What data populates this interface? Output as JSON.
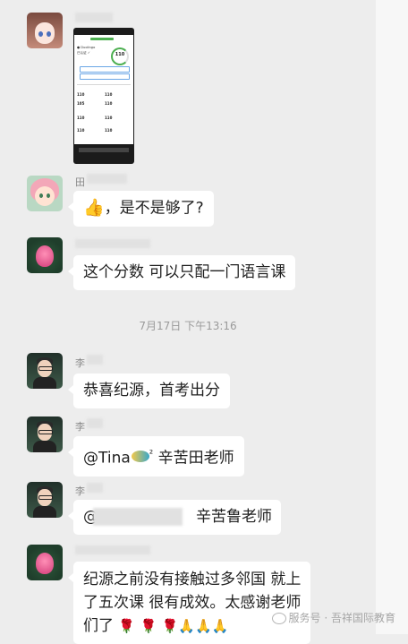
{
  "chat": {
    "time_separator": "7月17日 下午13:16",
    "messages": [
      {
        "sender": "",
        "type": "image",
        "image": {
          "score": "110"
        }
      },
      {
        "sender": "田",
        "text": "，是不是够了?",
        "emoji": "thumbs-up"
      },
      {
        "sender": "",
        "text": "这个分数 可以只配一门语言课"
      },
      {
        "sender": "李",
        "text": "恭喜纪源，首考出分"
      },
      {
        "sender": "李",
        "text_before": "@Tina",
        "emoji": "fish",
        "superscript": "²",
        "text_after": " 辛苦田老师"
      },
      {
        "sender": "李",
        "text_prefix": "@",
        "text_after": "辛苦鲁老师"
      },
      {
        "sender": "",
        "line1": "纪源之前没有接触过多邻国 就上",
        "line2": "了五次课 很有成效。太感谢老师",
        "line3": "们了"
      }
    ]
  },
  "watermark": {
    "text": "服务号 · 吾祥国际教育"
  },
  "colors": {
    "background": "#ededed",
    "bubble": "#ffffff",
    "accent_green": "#4caf50"
  }
}
